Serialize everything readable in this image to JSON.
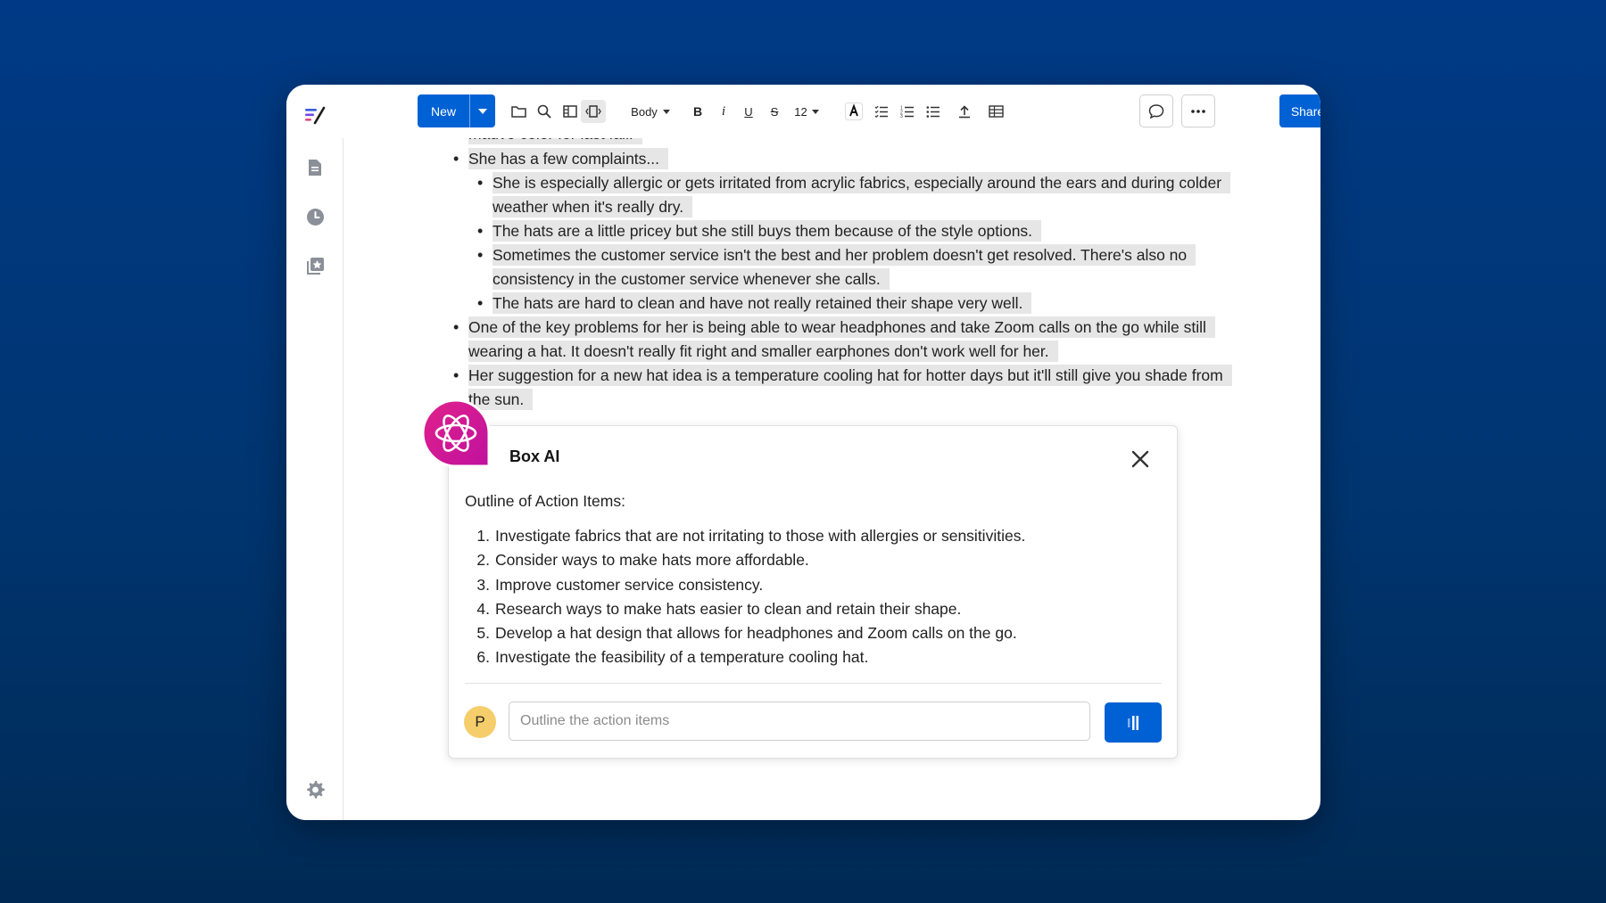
{
  "toolbar": {
    "new_label": "New",
    "style_label": "Body",
    "font_size_label": "12",
    "share_label": "Share"
  },
  "document": {
    "partial_line": "mauve color for last fall.",
    "item1": "She has a few complaints...",
    "sub1": "She is especially allergic or gets irritated from acrylic fabrics, especially around the ears and during colder weather when it's really dry.",
    "sub2": "The hats are a little pricey but she still buys them because of the style options.",
    "sub3": "Sometimes the customer service isn't the best and her problem doesn't get resolved. There's also no consistency in the customer service whenever she calls.",
    "sub4": "The hats are hard to clean and have not really retained their shape very well.",
    "item2": "One of the key problems for her is being able to wear headphones and take Zoom calls on the go while still wearing a hat. It doesn't really fit right and smaller earphones don't work well for her.",
    "item3": "Her suggestion for a new hat idea is a temperature cooling hat for hotter days but it'll still give you shade from the sun."
  },
  "ai_panel": {
    "title": "Box AI",
    "heading": "Outline of Action Items:",
    "items": [
      {
        "num": "1.",
        "text": "Investigate fabrics that are not irritating to those with allergies or sensitivities."
      },
      {
        "num": "2.",
        "text": "Consider ways to make hats more affordable."
      },
      {
        "num": "3.",
        "text": "Improve customer service consistency."
      },
      {
        "num": "4.",
        "text": "Research ways to make hats easier to clean and retain their shape."
      },
      {
        "num": "5.",
        "text": "Develop a hat design that allows for headphones and Zoom calls on the go."
      },
      {
        "num": "6.",
        "text": "Investigate the feasibility of a temperature cooling hat."
      }
    ],
    "avatar_initial": "P",
    "input_placeholder": "Outline the action items"
  },
  "colors": {
    "brand_blue": "#0061d5",
    "background": "#003a86",
    "ai_badge": "#d6168f",
    "avatar": "#f5cd6a"
  }
}
